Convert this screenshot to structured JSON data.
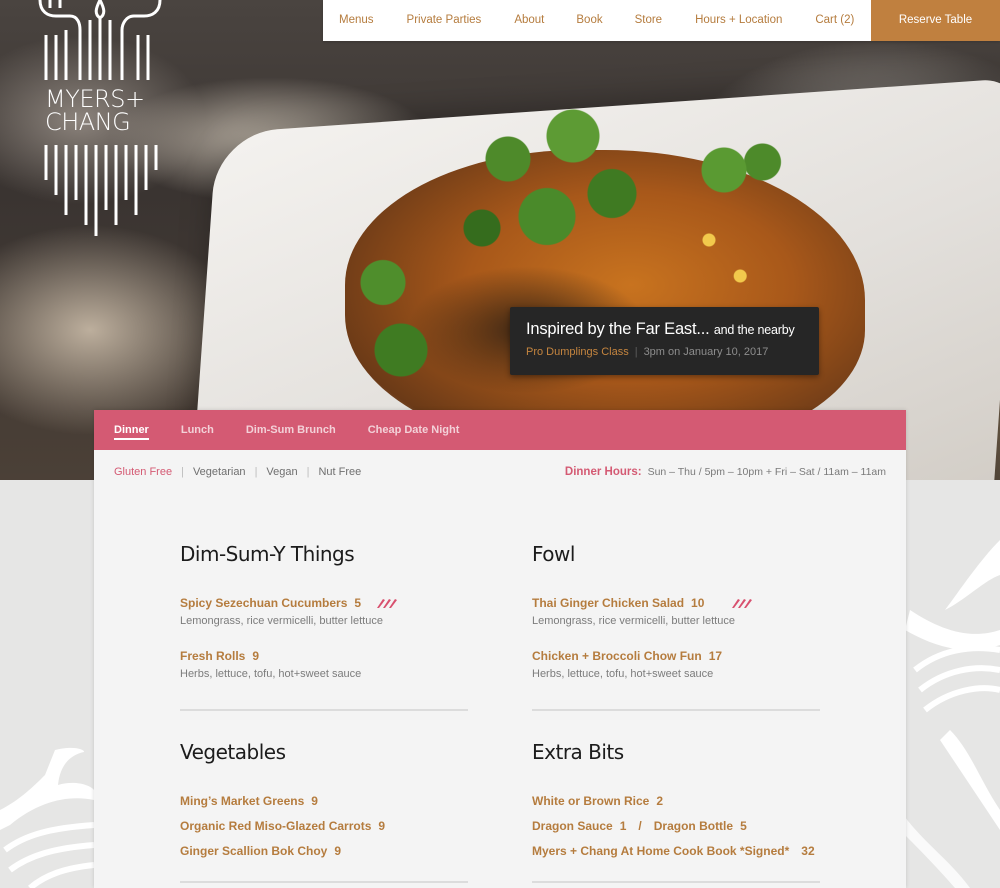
{
  "brand": {
    "line1": "MYERS+",
    "line2": "CHANG"
  },
  "nav": {
    "items": [
      {
        "label": "Menus"
      },
      {
        "label": "Private Parties"
      },
      {
        "label": "About"
      },
      {
        "label": "Book"
      },
      {
        "label": "Store"
      },
      {
        "label": "Hours + Location"
      },
      {
        "label": "Cart (2)"
      }
    ],
    "cta": "Reserve Table"
  },
  "event": {
    "headline": "Inspired by the Far East...",
    "headline_small": "and the nearby",
    "link": "Pro Dumplings Class",
    "separator": "|",
    "when": "3pm on January 10, 2017"
  },
  "menu_tabs": [
    {
      "label": "Dinner",
      "active": true
    },
    {
      "label": "Lunch",
      "active": false
    },
    {
      "label": "Dim-Sum Brunch",
      "active": false
    },
    {
      "label": "Cheap Date Night",
      "active": false
    }
  ],
  "filters": [
    {
      "label": "Gluten Free",
      "active": true
    },
    {
      "label": "Vegetarian",
      "active": false
    },
    {
      "label": "Vegan",
      "active": false
    },
    {
      "label": "Nut Free",
      "active": false
    }
  ],
  "filter_separator": "|",
  "hours": {
    "label": "Dinner Hours:",
    "value": "Sun – Thu / 5pm – 10pm + Fri – Sat / 11am – 11am"
  },
  "sections": [
    {
      "title": "Dim-Sum-Y Things",
      "items": [
        {
          "name": "Spicy Sezechuan Cucumbers",
          "price": "5",
          "desc": "Lemongrass, rice vermicelli, butter lettuce",
          "spicy": true
        },
        {
          "name": "Fresh Rolls",
          "price": "9",
          "desc": "Herbs, lettuce, tofu, hot+sweet sauce",
          "spicy": false
        }
      ]
    },
    {
      "title": "Fowl",
      "items": [
        {
          "name": "Thai Ginger Chicken Salad",
          "price": "10",
          "desc": "Lemongrass, rice vermicelli, butter lettuce",
          "spicy": true
        },
        {
          "name": "Chicken + Broccoli Chow Fun",
          "price": "17",
          "desc": "Herbs, lettuce, tofu, hot+sweet sauce",
          "spicy": false
        }
      ]
    },
    {
      "title": "Vegetables",
      "items": [
        {
          "name": "Ming’s Market Greens",
          "price": "9"
        },
        {
          "name": "Organic Red Miso-Glazed Carrots",
          "price": "9"
        },
        {
          "name": "Ginger Scallion Bok Choy",
          "price": "9"
        }
      ]
    },
    {
      "title": "Extra Bits",
      "items": [
        {
          "name": "White or Brown Rice",
          "price": "2"
        },
        {
          "name": "Dragon Sauce",
          "price": "1",
          "slash": "/",
          "name2": "Dragon Bottle",
          "price2": "5"
        },
        {
          "name": "Myers + Chang At Home Cook Book *Signed*",
          "price": "32"
        }
      ]
    }
  ],
  "colors": {
    "accent_pink": "#d45a73",
    "accent_gold": "#b57c3e",
    "reserve_button": "#c0803f",
    "event_card": "#262626"
  }
}
